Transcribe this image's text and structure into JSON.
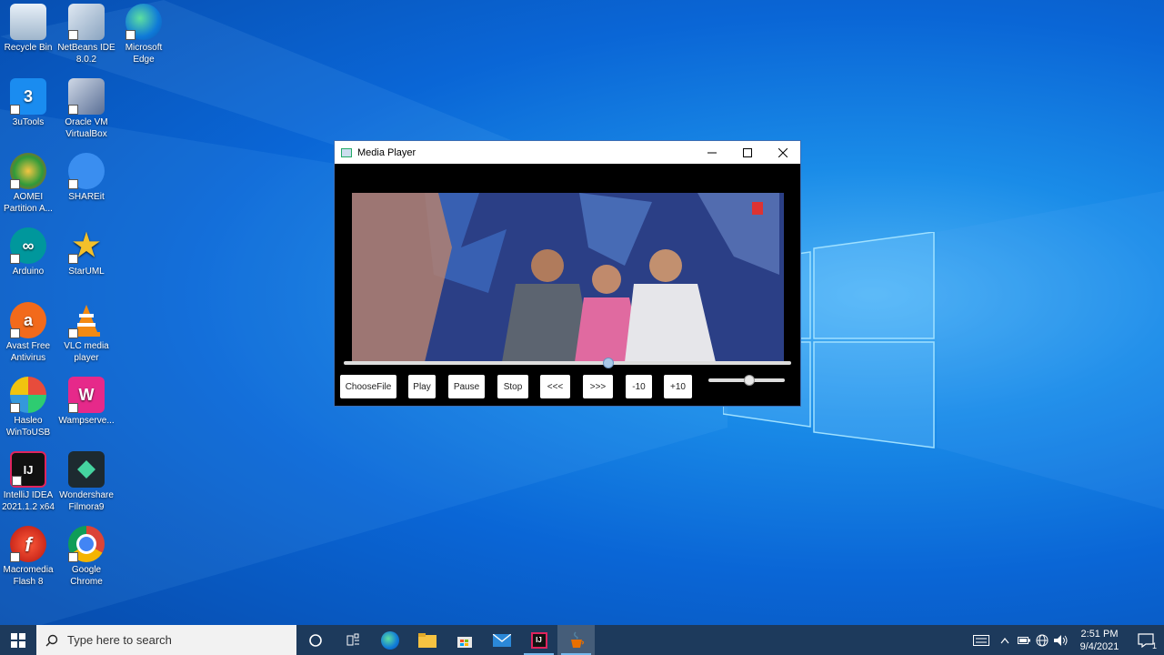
{
  "desktop": {
    "icons": [
      {
        "label": "Recycle Bin"
      },
      {
        "label": "NetBeans IDE 8.0.2"
      },
      {
        "label": "Microsoft Edge"
      },
      {
        "label": "3uTools"
      },
      {
        "label": "Oracle VM VirtualBox"
      },
      {
        "label": "AOMEI Partition A..."
      },
      {
        "label": "SHAREit"
      },
      {
        "label": "Arduino"
      },
      {
        "label": "StarUML"
      },
      {
        "label": "Avast Free Antivirus"
      },
      {
        "label": "VLC media player"
      },
      {
        "label": "Hasleo WinToUSB"
      },
      {
        "label": "Wampserve..."
      },
      {
        "label": "IntelliJ IDEA 2021.1.2 x64"
      },
      {
        "label": "Wondershare Filmora9"
      },
      {
        "label": "Macromedia Flash 8"
      },
      {
        "label": "Google Chrome"
      }
    ]
  },
  "player": {
    "title": "Media Player",
    "seek_progress": 0.59,
    "volume_level": 0.52,
    "buttons": {
      "choose": "ChooseFile",
      "play": "Play",
      "pause": "Pause",
      "stop": "Stop",
      "rewind": "<<<",
      "forward": ">>>",
      "minus10": "-10",
      "plus10": "+10"
    }
  },
  "taskbar": {
    "search_placeholder": "Type here to search",
    "time": "2:51 PM",
    "date": "9/4/2021",
    "notification_count": "1"
  },
  "colors": {
    "taskbar": "#1d3a5c",
    "accent": "#76b9ed"
  }
}
